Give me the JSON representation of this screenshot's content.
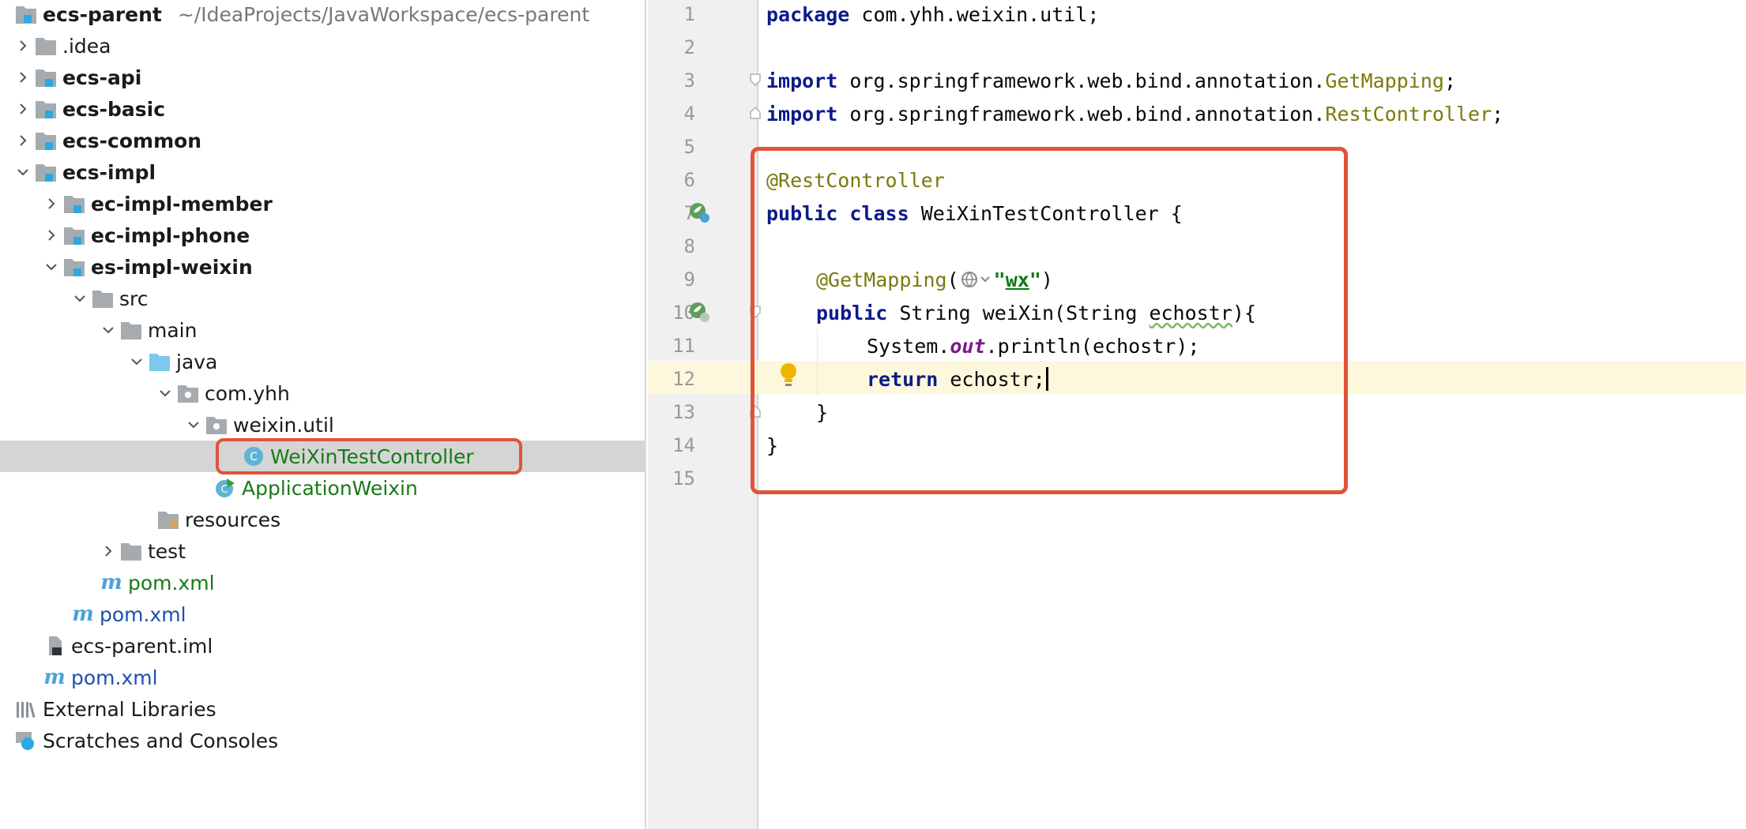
{
  "project_tree": {
    "root": {
      "label": "ecs-parent",
      "path": "~/IdeaProjects/JavaWorkspace/ecs-parent"
    },
    "items": [
      {
        "label": ".idea"
      },
      {
        "label": "ecs-api"
      },
      {
        "label": "ecs-basic"
      },
      {
        "label": "ecs-common"
      },
      {
        "label": "ecs-impl"
      },
      {
        "label": "ec-impl-member"
      },
      {
        "label": "ec-impl-phone"
      },
      {
        "label": "es-impl-weixin"
      },
      {
        "label": "src"
      },
      {
        "label": "main"
      },
      {
        "label": "java"
      },
      {
        "label": "com.yhh"
      },
      {
        "label": "weixin.util"
      },
      {
        "label": "WeiXinTestController"
      },
      {
        "label": "ApplicationWeixin"
      },
      {
        "label": "resources"
      },
      {
        "label": "test"
      },
      {
        "label": "pom.xml"
      },
      {
        "label": "pom.xml"
      },
      {
        "label": "ecs-parent.iml"
      },
      {
        "label": "pom.xml"
      },
      {
        "label": "External Libraries"
      },
      {
        "label": "Scratches and Consoles"
      }
    ]
  },
  "editor": {
    "line_numbers": [
      "1",
      "2",
      "3",
      "4",
      "5",
      "6",
      "7",
      "8",
      "9",
      "10",
      "11",
      "12",
      "13",
      "14",
      "15"
    ],
    "current_line": "12",
    "code": {
      "l1_kw": "package",
      "l1_rest": " com.yhh.weixin.util;",
      "import_kw": "import",
      "l3_pkg": " org.springframework.web.bind.annotation.",
      "l3_cls": "GetMapping",
      "l3_semi": ";",
      "l4_pkg": " org.springframework.web.bind.annotation.",
      "l4_cls": "RestController",
      "l4_semi": ";",
      "l6_ann": "@RestController",
      "public_kw": "public",
      "class_kw": "class",
      "l7_name": " WeiXinTestController {",
      "l9_ann": "@GetMapping",
      "paren_open": "(",
      "l9_str_q": "\"",
      "l9_str": "wx",
      "paren_close": ")",
      "l10_a": " String weiXin(String ",
      "l10_param": "echostr",
      "l10_b": "){",
      "l11_a": "System.",
      "l11_out": "out",
      "l11_b": ".println(echostr);",
      "return_kw": "return",
      "l12_rest": " echostr;",
      "l13_brace": "}",
      "l14_brace": "}"
    }
  },
  "colors": {
    "highlight": "#e0533a",
    "annotation": "#7a7a0a",
    "keyword": "#0b1b8a",
    "string": "#0b7a14"
  }
}
